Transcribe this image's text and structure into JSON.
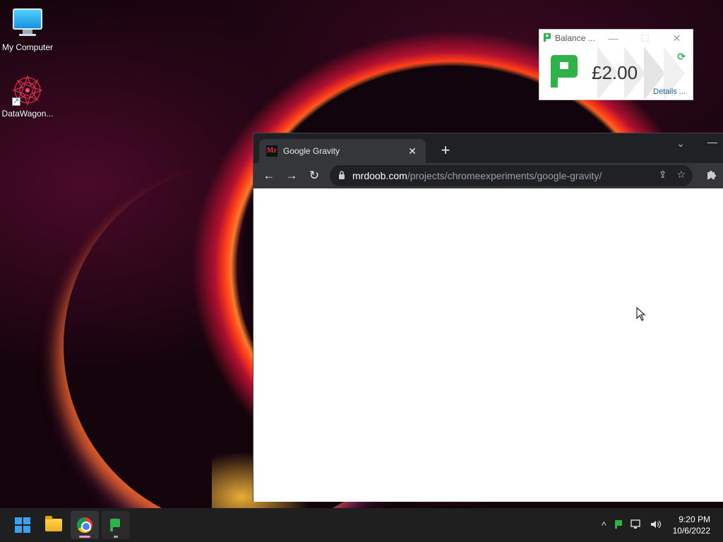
{
  "desktop": {
    "icons": [
      {
        "label": "My Computer",
        "icon": "monitor-icon"
      },
      {
        "label": "DataWagon...",
        "icon": "mandala-icon"
      }
    ]
  },
  "balance_widget": {
    "title": "Balance ...",
    "amount": "£2.00",
    "details_link": "Details ...",
    "minimize": "—",
    "maximize": "☐",
    "close": "✕",
    "refresh_icon": "⟳",
    "accent_color": "#2db34a"
  },
  "browser": {
    "tab": {
      "favicon_text": "Mr",
      "title": "Google Gravity",
      "close": "✕"
    },
    "new_tab": "+",
    "tab_search": "⌄",
    "minimize": "—",
    "nav": {
      "back": "←",
      "forward": "→",
      "reload": "↻"
    },
    "address": {
      "host": "mrdoob.com",
      "path": "/projects/chromeexperiments/google-gravity/"
    },
    "share_icon": "⇪",
    "bookmark_icon": "☆",
    "extensions_icon": "✚"
  },
  "taskbar": {
    "apps": [
      "start",
      "file-explorer",
      "chrome",
      "balance-app"
    ],
    "tray": {
      "overflow": "^",
      "network": "▭",
      "volume": "🔊"
    },
    "time": "9:20 PM",
    "date": "10/6/2022"
  }
}
